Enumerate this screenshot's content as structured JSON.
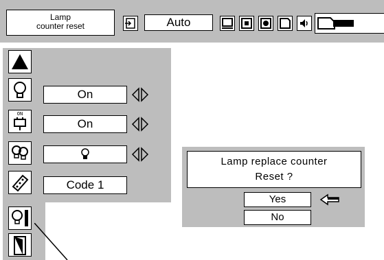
{
  "topbar": {
    "title_line1": "Lamp",
    "title_line2": "counter  reset",
    "input_value": "Auto",
    "icons": [
      "input-icon",
      "screen-icon",
      "image-icon",
      "color-icon",
      "setting-icon",
      "sound-icon",
      "lamp-counter-reset-icon"
    ]
  },
  "menu": {
    "items": [
      {
        "icon": "lamp-icon",
        "value": "On"
      },
      {
        "icon": "power-plug-icon",
        "icon_label": "ON",
        "value": "On"
      },
      {
        "icon": "lamp-mode-icon",
        "value": ""
      },
      {
        "icon": "remote-control-icon",
        "value": "Code 1"
      }
    ]
  },
  "dialog": {
    "line1": "Lamp replace counter",
    "line2": "Reset ?",
    "yes": "Yes",
    "no": "No"
  }
}
